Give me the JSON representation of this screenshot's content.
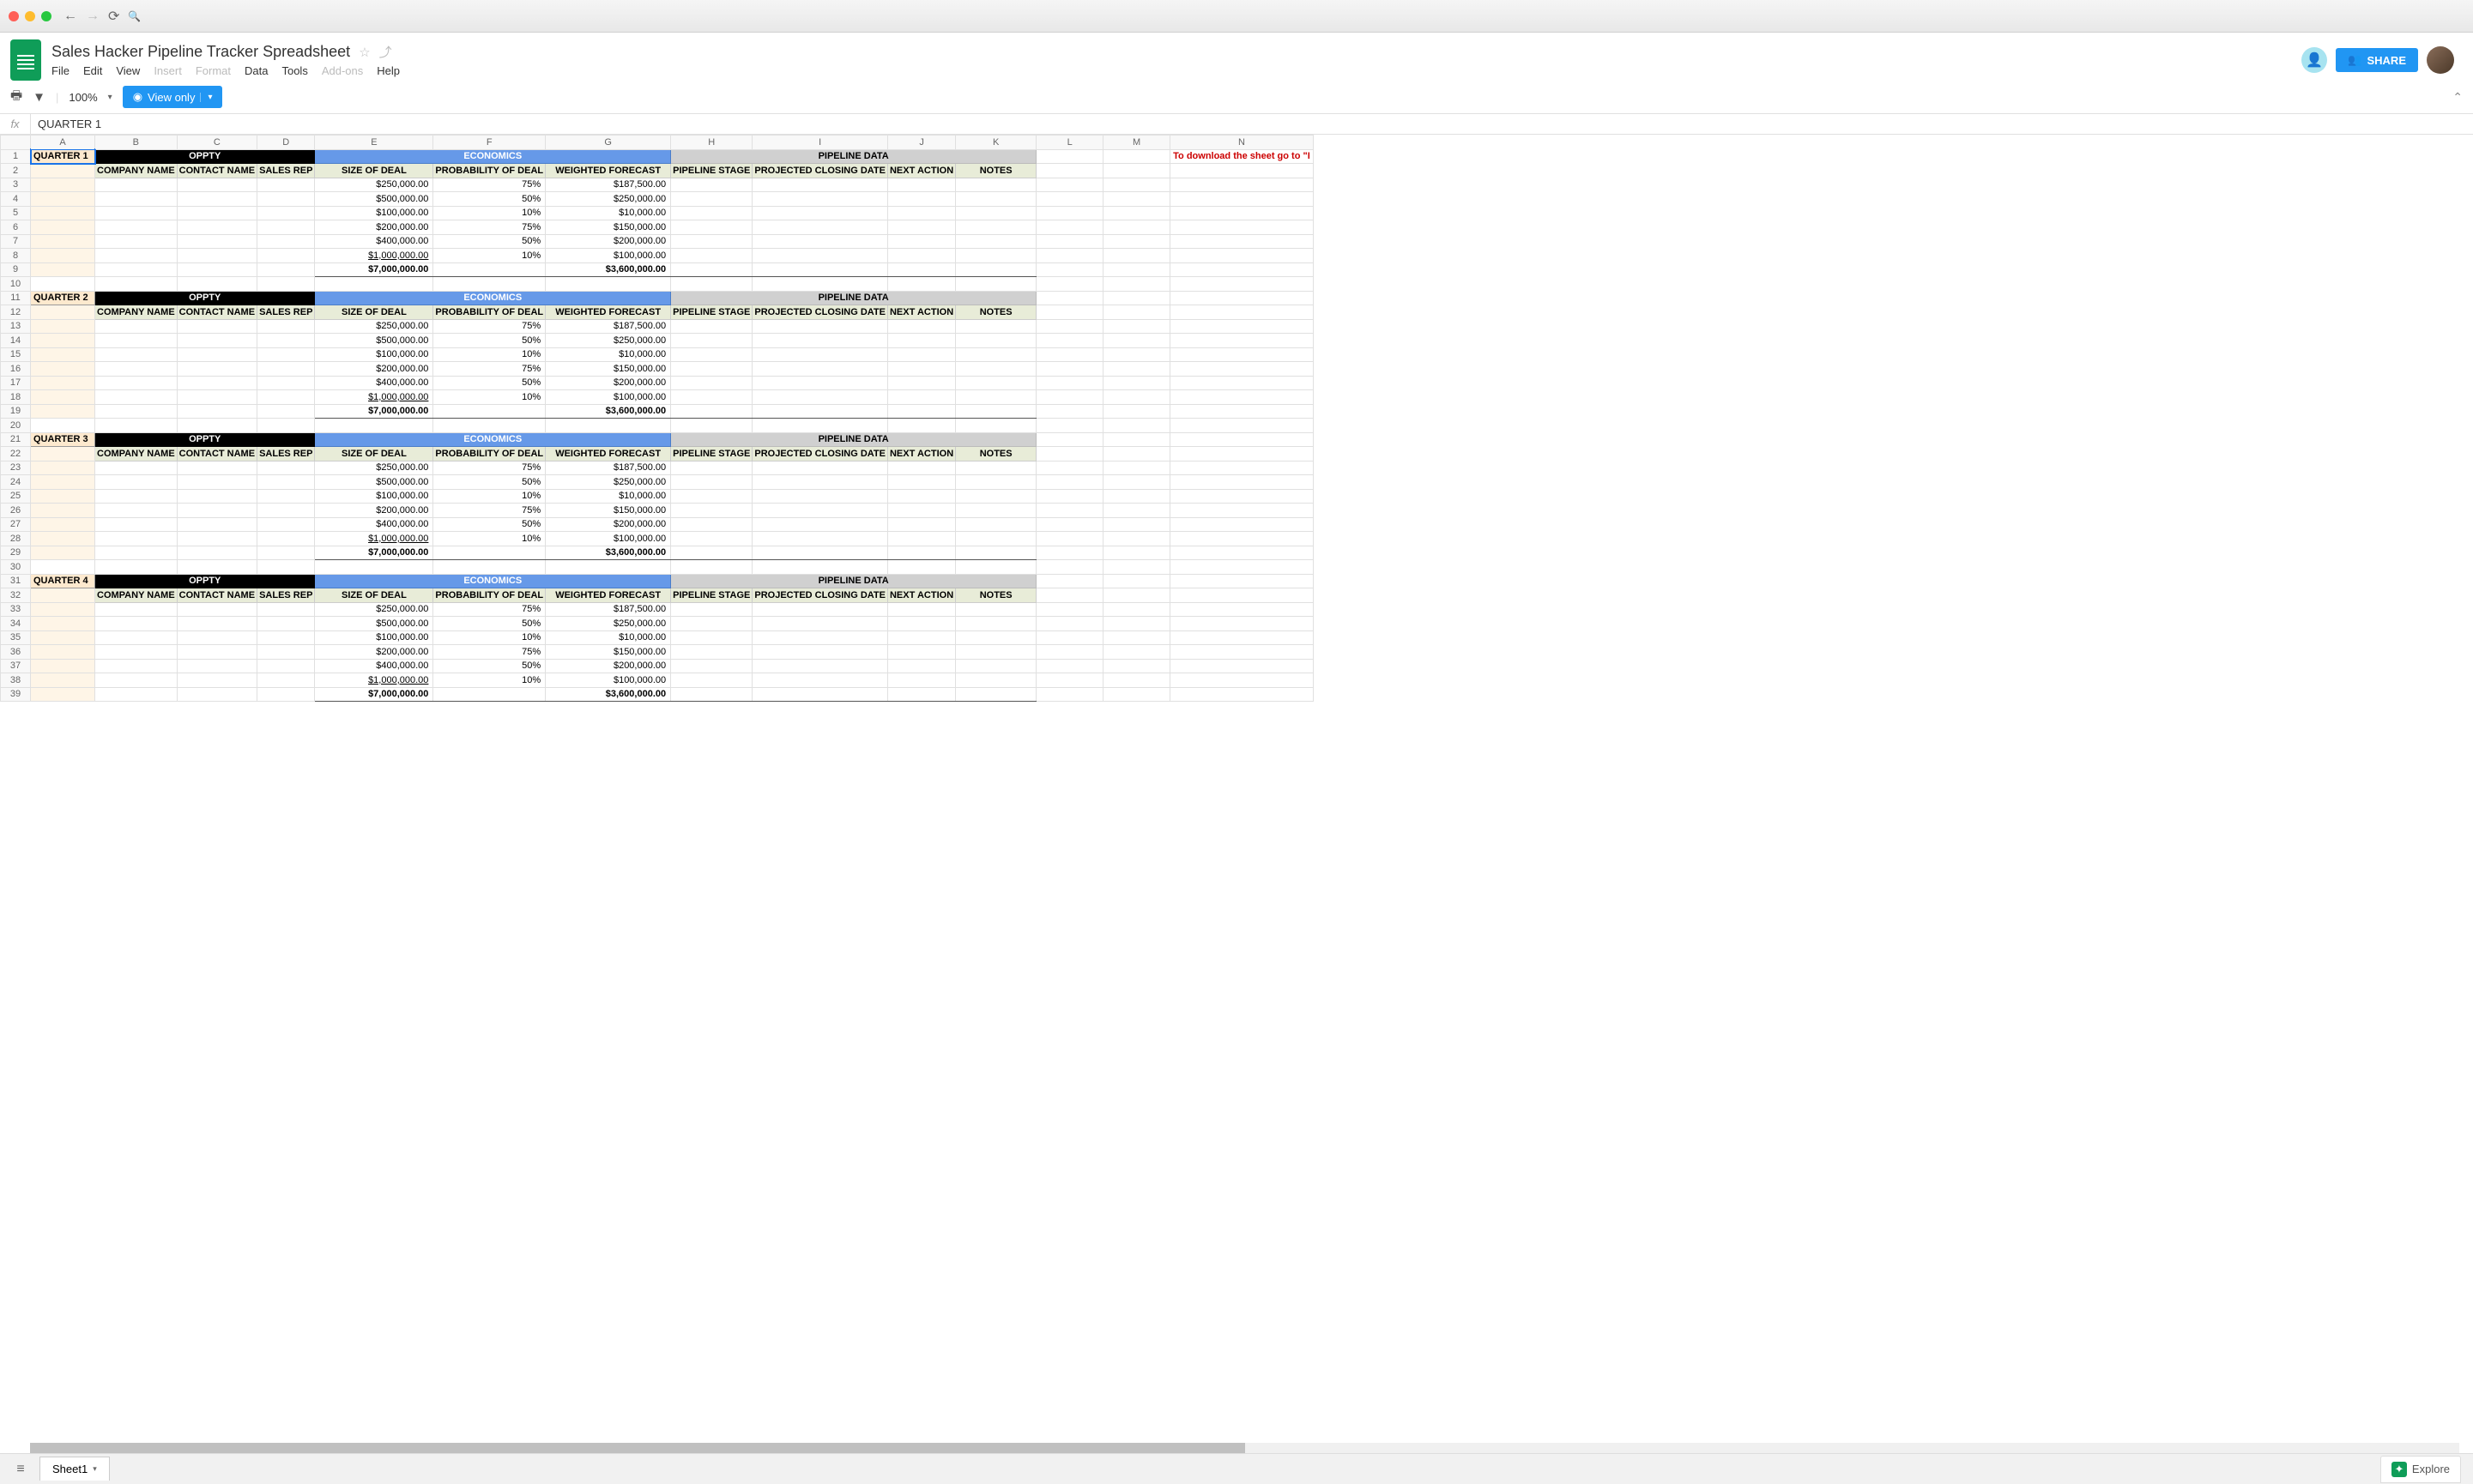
{
  "doc": {
    "title": "Sales Hacker Pipeline Tracker Spreadsheet",
    "menus": [
      "File",
      "Edit",
      "View",
      "Insert",
      "Format",
      "Data",
      "Tools",
      "Add-ons",
      "Help"
    ],
    "share": "SHARE",
    "zoom": "100%",
    "view_only": "View only",
    "formula": "QUARTER 1",
    "sheet_tab": "Sheet1",
    "explore": "Explore",
    "note": "To download the sheet go to \"I"
  },
  "columns": [
    "A",
    "B",
    "C",
    "D",
    "E",
    "F",
    "G",
    "H",
    "I",
    "J",
    "K",
    "L",
    "M",
    "N"
  ],
  "section_headers": {
    "oppty": "OPPTY",
    "economics": "ECONOMICS",
    "pipeline": "PIPELINE DATA"
  },
  "sub_headers": {
    "company": "COMPANY NAME",
    "contact": "CONTACT NAME",
    "rep": "SALES REP",
    "size": "SIZE OF DEAL",
    "prob": "PROBABILITY OF DEAL",
    "forecast": "WEIGHTED FORECAST",
    "stage": "PIPELINE STAGE",
    "closing": "PROJECTED CLOSING DATE",
    "next": "NEXT ACTION",
    "notes": "NOTES"
  },
  "quarters": [
    {
      "label": "QUARTER 1",
      "row": 1
    },
    {
      "label": "QUARTER 2",
      "row": 11
    },
    {
      "label": "QUARTER 3",
      "row": 21
    },
    {
      "label": "QUARTER 4",
      "row": 31
    }
  ],
  "data_rows": [
    {
      "size": "$250,000.00",
      "prob": "75%",
      "forecast": "$187,500.00"
    },
    {
      "size": "$500,000.00",
      "prob": "50%",
      "forecast": "$250,000.00"
    },
    {
      "size": "$100,000.00",
      "prob": "10%",
      "forecast": "$10,000.00"
    },
    {
      "size": "$200,000.00",
      "prob": "75%",
      "forecast": "$150,000.00"
    },
    {
      "size": "$400,000.00",
      "prob": "50%",
      "forecast": "$200,000.00"
    },
    {
      "size": "$1,000,000.00",
      "prob": "10%",
      "forecast": "$100,000.00"
    }
  ],
  "totals": {
    "size": "$7,000,000.00",
    "forecast": "$3,600,000.00"
  }
}
